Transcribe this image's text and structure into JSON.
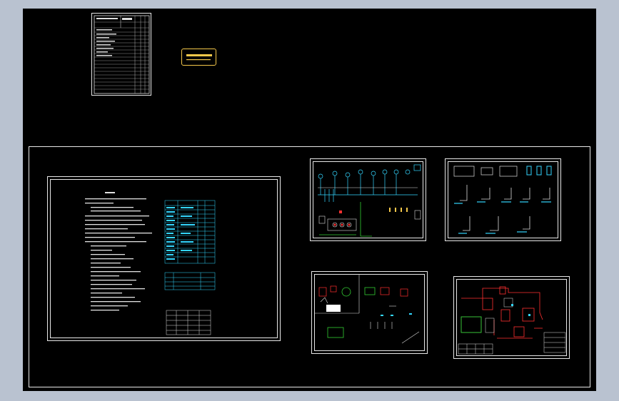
{
  "colors": {
    "background": "#000000",
    "window_bg": "#b9c2d0",
    "frame": "#e8e8e8",
    "cyan": "#33d6ff",
    "yellow": "#f5c84a",
    "red": "#ff3030",
    "green": "#33cc33",
    "white": "#ffffff"
  },
  "sheets": [
    {
      "id": "drawing-index-sheet"
    },
    {
      "id": "title-label"
    },
    {
      "id": "design-notes-sheet"
    },
    {
      "id": "system-diagram-sheet"
    },
    {
      "id": "riser-diagram-sheet"
    },
    {
      "id": "equipment-room-sheet"
    },
    {
      "id": "floor-plan-sheet"
    }
  ]
}
